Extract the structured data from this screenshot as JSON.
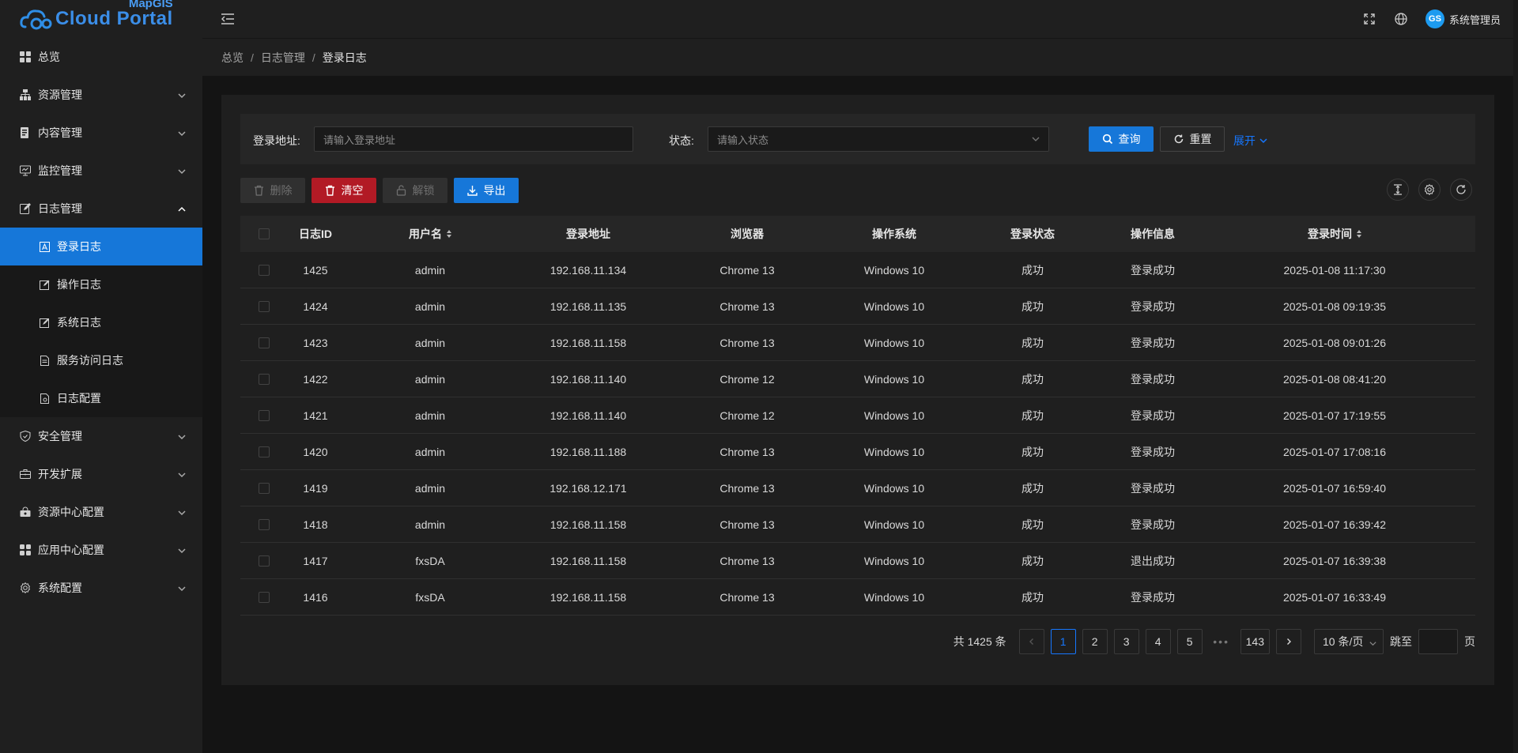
{
  "logo": {
    "top_text": "MapGIS",
    "main_text": "Cloud Portal"
  },
  "sidebar": {
    "items": [
      {
        "label": "总览",
        "icon": "dashboard-icon",
        "has_arrow": false
      },
      {
        "label": "资源管理",
        "icon": "sitemap-icon",
        "has_arrow": true
      },
      {
        "label": "内容管理",
        "icon": "document-icon",
        "has_arrow": true
      },
      {
        "label": "监控管理",
        "icon": "monitor-icon",
        "has_arrow": true
      },
      {
        "label": "日志管理",
        "icon": "edit-icon",
        "has_arrow": true,
        "expanded": true
      }
    ],
    "sub_items": [
      {
        "label": "登录日志",
        "icon": "login-log-icon",
        "active": true
      },
      {
        "label": "操作日志",
        "icon": "operation-log-icon"
      },
      {
        "label": "系统日志",
        "icon": "system-log-icon"
      },
      {
        "label": "服务访问日志",
        "icon": "service-log-icon"
      },
      {
        "label": "日志配置",
        "icon": "log-config-icon"
      }
    ],
    "items_after": [
      {
        "label": "安全管理",
        "icon": "shield-icon"
      },
      {
        "label": "开发扩展",
        "icon": "toolbox-icon"
      },
      {
        "label": "资源中心配置",
        "icon": "resource-center-icon"
      },
      {
        "label": "应用中心配置",
        "icon": "app-center-icon"
      },
      {
        "label": "系统配置",
        "icon": "gear-icon"
      }
    ]
  },
  "header": {
    "username": "系统管理员",
    "avatar_text": "GS"
  },
  "breadcrumb": [
    "总览",
    "日志管理",
    "登录日志"
  ],
  "search": {
    "address_label": "登录地址:",
    "address_placeholder": "请输入登录地址",
    "status_label": "状态:",
    "status_placeholder": "请输入状态",
    "query_button": "查询",
    "reset_button": "重置",
    "expand_link": "展开"
  },
  "toolbar": {
    "delete": "删除",
    "clear": "清空",
    "unlock": "解锁",
    "export": "导出"
  },
  "table": {
    "columns": [
      "日志ID",
      "用户名",
      "登录地址",
      "浏览器",
      "操作系统",
      "登录状态",
      "操作信息",
      "登录时间"
    ],
    "rows": [
      [
        "1425",
        "admin",
        "192.168.11.134",
        "Chrome 13",
        "Windows 10",
        "成功",
        "登录成功",
        "2025-01-08 11:17:30"
      ],
      [
        "1424",
        "admin",
        "192.168.11.135",
        "Chrome 13",
        "Windows 10",
        "成功",
        "登录成功",
        "2025-01-08 09:19:35"
      ],
      [
        "1423",
        "admin",
        "192.168.11.158",
        "Chrome 13",
        "Windows 10",
        "成功",
        "登录成功",
        "2025-01-08 09:01:26"
      ],
      [
        "1422",
        "admin",
        "192.168.11.140",
        "Chrome 12",
        "Windows 10",
        "成功",
        "登录成功",
        "2025-01-08 08:41:20"
      ],
      [
        "1421",
        "admin",
        "192.168.11.140",
        "Chrome 12",
        "Windows 10",
        "成功",
        "登录成功",
        "2025-01-07 17:19:55"
      ],
      [
        "1420",
        "admin",
        "192.168.11.188",
        "Chrome 13",
        "Windows 10",
        "成功",
        "登录成功",
        "2025-01-07 17:08:16"
      ],
      [
        "1419",
        "admin",
        "192.168.12.171",
        "Chrome 13",
        "Windows 10",
        "成功",
        "登录成功",
        "2025-01-07 16:59:40"
      ],
      [
        "1418",
        "admin",
        "192.168.11.158",
        "Chrome 13",
        "Windows 10",
        "成功",
        "登录成功",
        "2025-01-07 16:39:42"
      ],
      [
        "1417",
        "fxsDA",
        "192.168.11.158",
        "Chrome 13",
        "Windows 10",
        "成功",
        "退出成功",
        "2025-01-07 16:39:38"
      ],
      [
        "1416",
        "fxsDA",
        "192.168.11.158",
        "Chrome 13",
        "Windows 10",
        "成功",
        "登录成功",
        "2025-01-07 16:33:49"
      ]
    ]
  },
  "pagination": {
    "total_text": "共 1425 条",
    "pages": [
      "1",
      "2",
      "3",
      "4",
      "5"
    ],
    "current": "1",
    "ellipsis": "•••",
    "last_page": "143",
    "page_size": "10 条/页",
    "jump_label": "跳至",
    "page_suffix": "页"
  },
  "colors": {
    "primary": "#1677d9",
    "danger": "#b21a25",
    "sidebar_bg": "#1f1f1f"
  }
}
